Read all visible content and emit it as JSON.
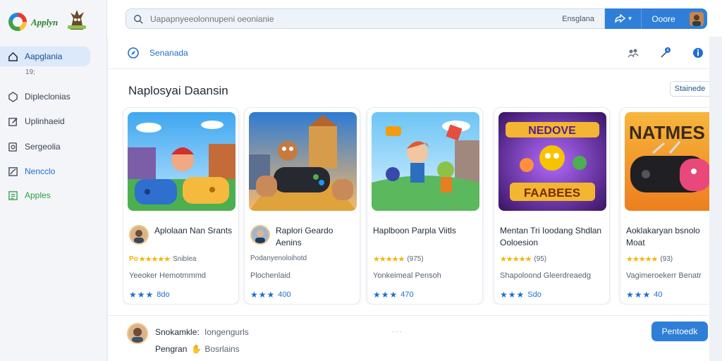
{
  "app": {
    "logo_text": "Applyn"
  },
  "sidebar": {
    "items": [
      {
        "label": "Aapglania",
        "icon": "home-icon",
        "active": true
      },
      {
        "label": "Dipleclonias",
        "icon": "hexagon-icon"
      },
      {
        "label": "Uplinhaeid",
        "icon": "edit-icon"
      },
      {
        "label": "Sergeolia",
        "icon": "search-doc-icon"
      },
      {
        "label": "Nencclo",
        "icon": "chart-icon"
      },
      {
        "label": "Apples",
        "icon": "list-icon"
      }
    ],
    "sub_label": "19;"
  },
  "search": {
    "placeholder": "Uapapnyeeolonnupeni oeonianie",
    "tag": "Ensglana"
  },
  "top_actions": {
    "button_label": "Ooore"
  },
  "subheader": {
    "title": "Senanada"
  },
  "section": {
    "title": "Naplosyai Daansin",
    "button": "Stainede"
  },
  "cards": [
    {
      "title": "Aplolaan Nan Srants",
      "rating_prefix": "Po",
      "stars": "★★★★★",
      "rating_text": "Sniblea",
      "subtitle": "Yeeoker Hemotmmmd",
      "foot_stars": "★★★",
      "foot_value": "8do",
      "has_avatar": true
    },
    {
      "title": "Raplori Geardo Aenins",
      "rating_prefix": "",
      "stars": "",
      "rating_text": "Podanyenoloihotd",
      "subtitle": "Plochenlaid",
      "foot_stars": "★★★",
      "foot_value": "400",
      "has_avatar": true
    },
    {
      "title": "Haplboon Parpla Viitls",
      "rating_prefix": "",
      "stars": "★★★★★",
      "rating_text": "(975)",
      "subtitle": "Yonkeimeal Pensoh",
      "foot_stars": "★★★",
      "foot_value": "470",
      "has_avatar": false
    },
    {
      "title": "Mentan Tri Ioodang Shdlan Ooloesion",
      "rating_prefix": "",
      "stars": "★★★★★",
      "rating_text": "(95)",
      "subtitle": "Shapoloond Gleerdreaedg",
      "foot_stars": "★★★",
      "foot_value": "Sdo",
      "has_avatar": false
    },
    {
      "title": "Aoklakaryan bsnolo Moat",
      "rating_prefix": "",
      "stars": "★★★★★",
      "rating_text": "(93)",
      "subtitle": "Vagimeroekerr Benatr",
      "foot_stars": "★★★",
      "foot_value": "40",
      "has_avatar": false
    }
  ],
  "bottom": {
    "user_name": "Snokamkle:",
    "user_meta": "Iongengurls",
    "mid_text": "· · ·",
    "line2_name": "Pengran",
    "line2_meta": "Bosrlains",
    "button": "Pentoedk"
  },
  "colors": {
    "accent": "#2f7fd8",
    "sidebar_active": "#dbe9fa",
    "star": "#f5b400"
  }
}
